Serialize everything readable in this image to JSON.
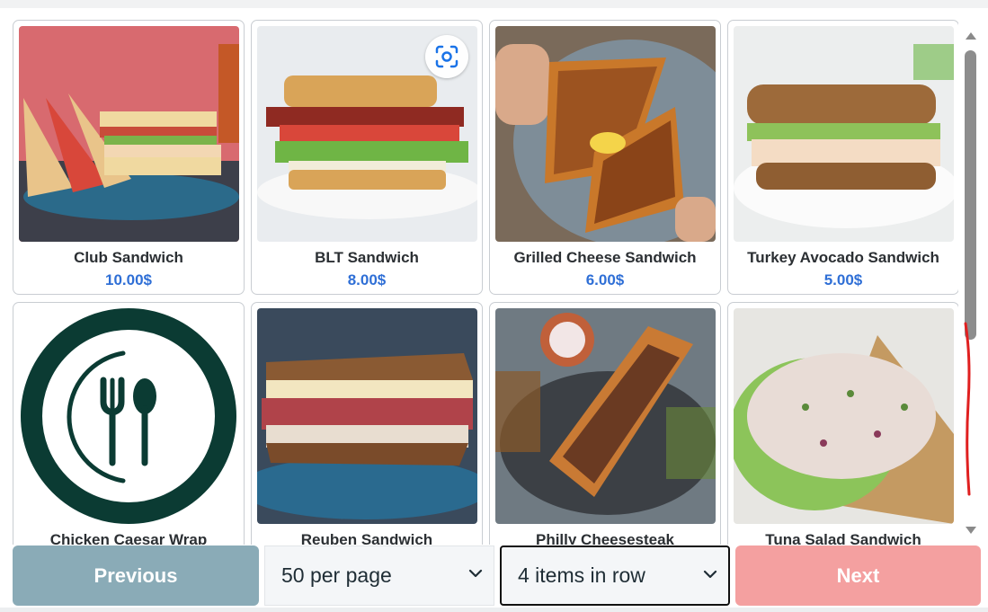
{
  "products": [
    {
      "name": "Club Sandwich",
      "price": "10.00$",
      "icon": "club-sandwich-photo"
    },
    {
      "name": "BLT Sandwich",
      "price": "8.00$",
      "icon": "blt-sandwich-photo"
    },
    {
      "name": "Grilled Cheese Sandwich",
      "price": "6.00$",
      "icon": "grilled-cheese-photo"
    },
    {
      "name": "Turkey Avocado Sandwich",
      "price": "5.00$",
      "icon": "turkey-avocado-photo"
    },
    {
      "name": "Chicken Caesar Wrap",
      "price": "",
      "icon": "plate-fork-spoon-placeholder"
    },
    {
      "name": "Reuben Sandwich",
      "price": "",
      "icon": "reuben-sandwich-photo"
    },
    {
      "name": "Philly Cheesesteak",
      "price": "",
      "icon": "philly-cheesesteak-photo"
    },
    {
      "name": "Tuna Salad Sandwich",
      "price": "",
      "icon": "tuna-salad-photo"
    }
  ],
  "controls": {
    "previous_label": "Previous",
    "next_label": "Next",
    "per_page_value": "50 per page",
    "items_in_row_value": "4 items in row"
  },
  "colors": {
    "price": "#2f6fd6",
    "previous_bg": "#8aabb7",
    "next_bg": "#f4a0a0",
    "placeholder_icon": "#0b3b33"
  }
}
